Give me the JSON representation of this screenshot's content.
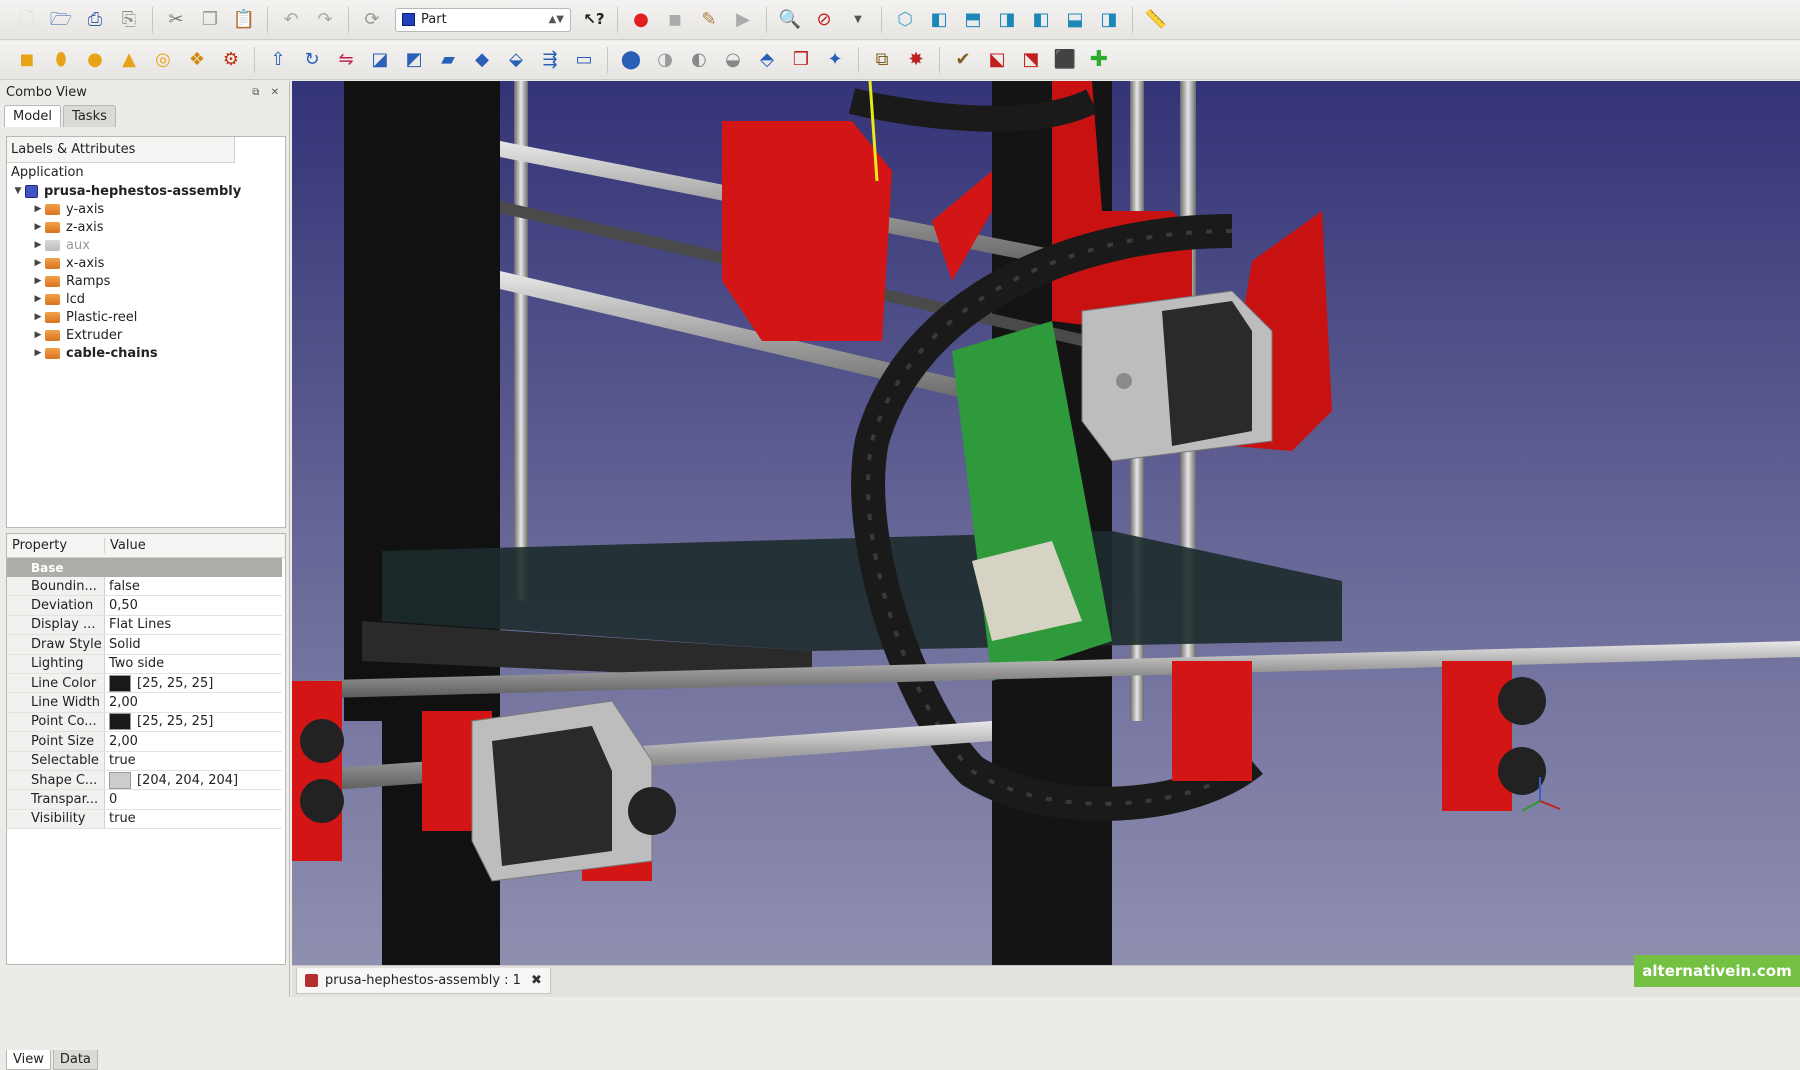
{
  "toolbar1": {
    "icons": [
      "new-icon",
      "open-icon",
      "save-icon",
      "save-as-icon",
      "cut-icon",
      "copy-icon",
      "paste-icon",
      "undo-icon",
      "redo-icon",
      "refresh-icon"
    ],
    "workbench_value": "Part",
    "macro_icons": [
      "whats-this-icon",
      "record-macro-icon",
      "stop-macro-icon",
      "edit-macro-icon",
      "execute-macro-icon"
    ],
    "view_icons": [
      "fit-all-icon",
      "draw-style-icon",
      "isometric-view-icon",
      "front-view-icon",
      "top-view-icon",
      "right-view-icon",
      "rear-view-icon",
      "bottom-view-icon",
      "left-view-icon",
      "measure-icon"
    ]
  },
  "toolbar2": {
    "icons": [
      "box-icon",
      "cylinder-icon",
      "sphere-icon",
      "cone-icon",
      "torus-icon",
      "primitives-icon",
      "shape-builder-icon",
      "extrude-icon",
      "revolve-icon",
      "mirror-icon",
      "fillet-icon",
      "chamfer-icon",
      "face-maker-icon",
      "ruled-surface-icon",
      "loft-icon",
      "sweep-icon",
      "offset-icon",
      "thickness-icon",
      "union-icon",
      "cut-op-icon",
      "intersect-icon",
      "section-icon",
      "cross-section-icon",
      "boolean-icon",
      "split-icon",
      "compound-icon",
      "explode-icon",
      "check-geometry-icon",
      "defeaturing-icon",
      "attach-icon",
      "add-icon"
    ]
  },
  "combo_view": {
    "title": "Combo View",
    "tabs": [
      "Model",
      "Tasks"
    ],
    "tree_header": "Labels & Attributes",
    "application_label": "Application",
    "document": "prusa-hephestos-assembly",
    "items": [
      {
        "label": "y-axis",
        "bold": false,
        "greyed": false
      },
      {
        "label": "z-axis",
        "bold": false,
        "greyed": false
      },
      {
        "label": "aux",
        "bold": false,
        "greyed": true
      },
      {
        "label": "x-axis",
        "bold": false,
        "greyed": false
      },
      {
        "label": "Ramps",
        "bold": false,
        "greyed": false
      },
      {
        "label": "lcd",
        "bold": false,
        "greyed": false
      },
      {
        "label": "Plastic-reel",
        "bold": false,
        "greyed": false
      },
      {
        "label": "Extruder",
        "bold": false,
        "greyed": false
      },
      {
        "label": "cable-chains",
        "bold": true,
        "greyed": false
      }
    ]
  },
  "properties": {
    "header_property": "Property",
    "header_value": "Value",
    "group": "Base",
    "rows": [
      {
        "name": "Boundin...",
        "value": "false"
      },
      {
        "name": "Deviation",
        "value": "0,50"
      },
      {
        "name": "Display ...",
        "value": "Flat Lines"
      },
      {
        "name": "Draw Style",
        "value": "Solid"
      },
      {
        "name": "Lighting",
        "value": "Two side"
      },
      {
        "name": "Line Color",
        "value": "[25, 25, 25]",
        "swatch": "#191919"
      },
      {
        "name": "Line Width",
        "value": "2,00"
      },
      {
        "name": "Point Co...",
        "value": "[25, 25, 25]",
        "swatch": "#191919"
      },
      {
        "name": "Point Size",
        "value": "2,00"
      },
      {
        "name": "Selectable",
        "value": "true"
      },
      {
        "name": "Shape C...",
        "value": "[204, 204, 204]",
        "swatch": "#cccccc"
      },
      {
        "name": "Transpar...",
        "value": "0"
      },
      {
        "name": "Visibility",
        "value": "true"
      }
    ]
  },
  "bottom_tabs": [
    "View",
    "Data"
  ],
  "document_tab": {
    "label": "prusa-hephestos-assembly : 1",
    "close": "✖"
  },
  "watermark": "alternativein.com",
  "colors": {
    "accent_red": "#d41515",
    "bg_top": "#333377",
    "bg_bottom": "#8f8fb0",
    "frame_black": "#151515",
    "pcb_green": "#1f8a2e"
  }
}
